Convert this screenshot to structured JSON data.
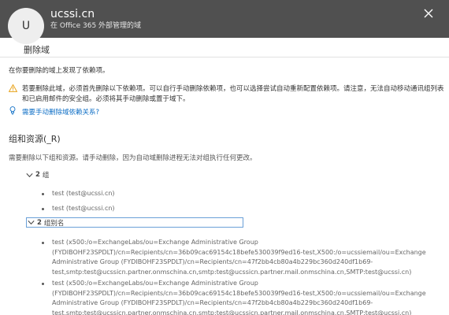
{
  "header": {
    "avatar_letter": "U",
    "domain": "ucssi.cn",
    "subtitle": "在 Office 365 外部管理的域"
  },
  "section": {
    "title": "删除域"
  },
  "intro": "在你要删除的域上发现了依赖项。",
  "warning": "若要删除此域，必须首先删除以下依赖项。可以自行手动删除依赖项，也可以选择尝试自动重新配置依赖项。请注意，无法自动移动通讯组列表和已启用邮件的安全组。必须将其手动删除或置于域下。",
  "help_link": "需要手动删除域依赖关系?",
  "groups": {
    "heading": "组和资源(_R)",
    "note": "需要删除以下组和资源。请手动删除，因为自动域删除进程无法对组执行任何更改。",
    "group_count": "2",
    "group_label": "组",
    "group_items": [
      "test (test@ucssi.cn)",
      "test (test@ucssi.cn)"
    ],
    "alias_count": "2",
    "alias_label": "组别名",
    "alias_items": [
      "test (x500:/o=ExchangeLabs/ou=Exchange Administrative Group (FYDIBOHF23SPDLT)/cn=Recipients/cn=36b09cac69154c18befe530039f9ed16-test,X500:/o=ucssiemail/ou=Exchange Administrative Group (FYDIBOHF23SPDLT)/cn=Recipients/cn=47f2bb4cb80a4b229bc360d240df1b69-test,smtp:test@ucssicn.partner.onmschina.cn,smtp:test@ucssicn.partner.mail.onmschina.cn,SMTP:test@ucssi.cn)",
      "test (x500:/o=ExchangeLabs/ou=Exchange Administrative Group (FYDIBOHF23SPDLT)/cn=Recipients/cn=36b09cac69154c18befe530039f9ed16-test,X500:/o=ucssiemail/ou=Exchange Administrative Group (FYDIBOHF23SPDLT)/cn=Recipients/cn=47f2bb4cb80a4b229bc360d240df1b69-test,smtp:test@ucssicn.partner.onmschina.cn,smtp:test@ucssicn.partner.mail.onmschina.cn,SMTP:test@ucssi.cn)"
    ]
  },
  "colors": {
    "header_bg": "#505050",
    "link": "#0f6fc6",
    "warning": "#e8a21a",
    "focus_border": "#6aa0d8"
  }
}
